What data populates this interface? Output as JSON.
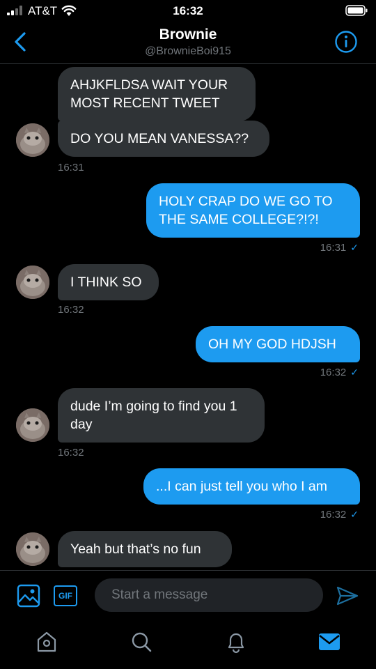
{
  "status_bar": {
    "carrier": "AT&T",
    "time": "16:32"
  },
  "header": {
    "name": "Brownie",
    "handle": "@BrownieBoi915"
  },
  "messages": [
    {
      "text": "AHJKFLDSA WAIT YOUR MOST RECENT TWEET",
      "from": "them"
    },
    {
      "text": "DO YOU MEAN VANESSA??",
      "from": "them",
      "time": "16:31"
    },
    {
      "text": "HOLY CRAP DO WE GO TO THE SAME COLLEGE?!?!",
      "from": "me",
      "time": "16:31"
    },
    {
      "text": "I THINK SO",
      "from": "them",
      "time": "16:32"
    },
    {
      "text": "OH MY GOD HDJSH",
      "from": "me",
      "time": "16:32"
    },
    {
      "text": "dude I’m going to find you 1 day",
      "from": "them",
      "time": "16:32"
    },
    {
      "text": "...I can just tell you who I am",
      "from": "me",
      "time": "16:32"
    },
    {
      "text": "Yeah but that’s no fun",
      "from": "them"
    }
  ],
  "read_mark": "✓",
  "composer": {
    "gif_label": "GIF",
    "placeholder": "Start a message"
  },
  "tabs": [
    "home-icon",
    "search-icon",
    "notifications-icon",
    "messages-icon"
  ],
  "colors": {
    "accent": "#1d9bf0",
    "bubble_in": "#2f3336",
    "background": "#000000"
  }
}
